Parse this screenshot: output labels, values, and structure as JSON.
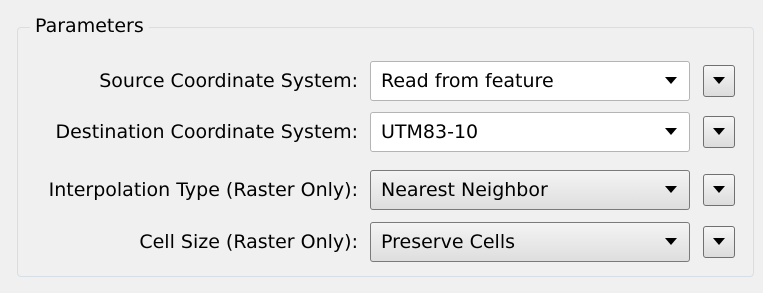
{
  "group": {
    "title": "Parameters"
  },
  "rows": [
    {
      "label": "Source Coordinate System:",
      "value": "Read from feature",
      "style": "editable"
    },
    {
      "label": "Destination Coordinate System:",
      "value": "UTM83-10",
      "style": "editable"
    },
    {
      "label": "Interpolation Type (Raster Only):",
      "value": "Nearest Neighbor",
      "style": "dropdown"
    },
    {
      "label": "Cell Size (Raster Only):",
      "value": "Preserve Cells",
      "style": "dropdown"
    }
  ],
  "icons": {
    "combo_arrow": "chevron-down-icon",
    "side_button": "menu-dropdown-icon"
  }
}
